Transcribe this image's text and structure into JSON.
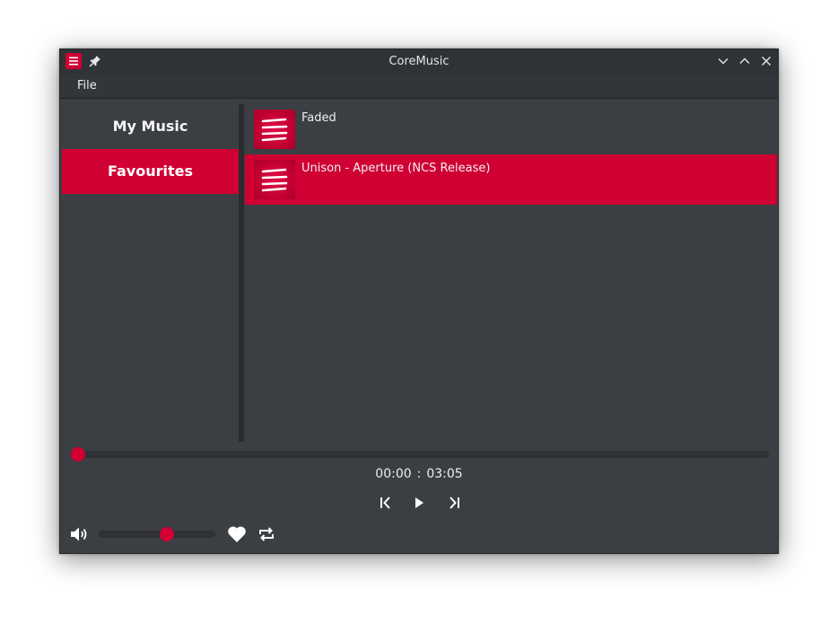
{
  "window": {
    "title": "CoreMusic"
  },
  "menubar": {
    "file_label": "File"
  },
  "sidebar": {
    "items": [
      {
        "label": "My Music",
        "active": false
      },
      {
        "label": "Favourites",
        "active": true
      }
    ]
  },
  "songs": [
    {
      "title": "Faded",
      "active": false
    },
    {
      "title": "Unison - Aperture (NCS Release)",
      "active": true
    }
  ],
  "player": {
    "current_time": "00:00",
    "separator": ":",
    "total_time": "03:05",
    "progress": 0.0,
    "volume": 0.6
  },
  "icons": {
    "app": "menu-lines-icon",
    "pin": "pin-icon",
    "minimize": "chevron-down-icon",
    "maximize": "chevron-up-icon",
    "close": "close-icon",
    "prev": "skip-previous-icon",
    "play": "play-icon",
    "next": "skip-next-icon",
    "volume": "speaker-icon",
    "favourite": "heart-icon",
    "repeat": "repeat-icon"
  },
  "colors": {
    "accent": "#d00033",
    "background": "#3b3e42",
    "titlebar": "#2f3236",
    "text": "#eeeeee"
  }
}
